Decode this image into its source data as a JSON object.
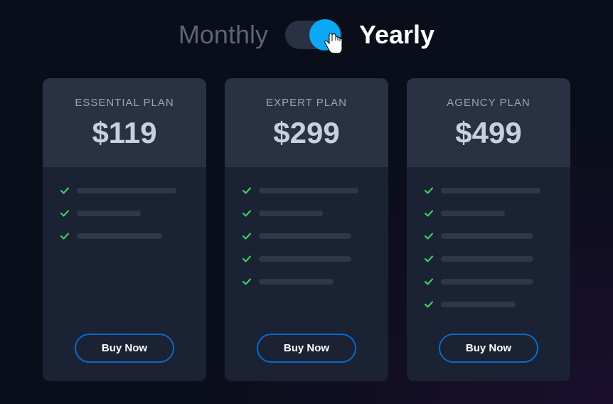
{
  "toggle": {
    "monthly_label": "Monthly",
    "yearly_label": "Yearly",
    "state": "yearly"
  },
  "plans": [
    {
      "name": "ESSENTIAL PLAN",
      "price": "$119",
      "feature_bars": [
        140,
        90,
        120
      ],
      "buy_label": "Buy Now"
    },
    {
      "name": "EXPERT PLAN",
      "price": "$299",
      "feature_bars": [
        140,
        90,
        130,
        130,
        105
      ],
      "buy_label": "Buy Now"
    },
    {
      "name": "AGENCY PLAN",
      "price": "$499",
      "feature_bars": [
        140,
        90,
        130,
        130,
        130,
        105
      ],
      "buy_label": "Buy Now"
    }
  ]
}
